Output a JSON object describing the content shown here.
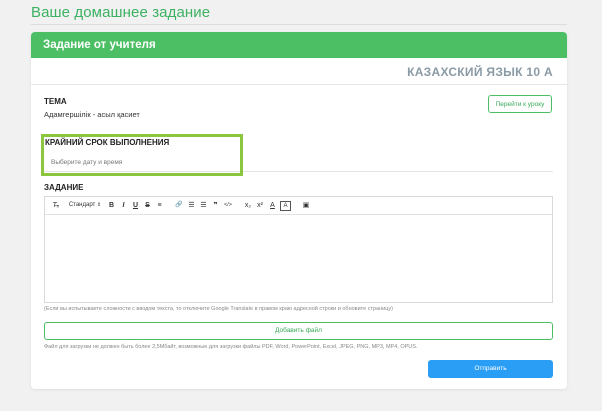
{
  "page": {
    "heading": "Ваше домашнее задание"
  },
  "card": {
    "header": "Задание от учителя",
    "subject": "КАЗАХСКИЙ ЯЗЫК 10 А"
  },
  "topic": {
    "label": "ТЕМА",
    "value": "Адамгершілік - асыл қасиет",
    "goto_button": "Перейти к уроку"
  },
  "deadline": {
    "label": "КРАЙНИЙ СРОК ВЫПОЛНЕНИЯ",
    "placeholder": "Выберите дату и время"
  },
  "assignment": {
    "label": "ЗАДАНИЕ",
    "toolbar": {
      "clear_format": "T̶ₓ",
      "style": "Стандарт",
      "bold": "B",
      "italic": "I",
      "underline": "U",
      "strike": "S",
      "align": "≡",
      "link": "🔗",
      "ol": "☰",
      "ul": "☰",
      "quote": "❞",
      "code": "</>",
      "subscript": "x₂",
      "superscript": "x²",
      "text_color": "A",
      "bg_color": "A",
      "video": "▣"
    },
    "hint": "(Если вы испытываете сложности с вводом текста, то отключите Google Translate в правом краю адресной строки и обновите страницу)"
  },
  "files": {
    "add_button": "Добавить файл",
    "note": "Файл для загрузки не должен быть более 2,5Мбайт, возможные для загрузки файлы PDF, Word, PowerPoint, Excel, JPEG, PNG, MP3, MP4, OPUS."
  },
  "submit": {
    "label": "Отправить"
  },
  "colors": {
    "accent_green": "#4cbf65",
    "submit_blue": "#2a9df4",
    "highlight": "#8cc63f"
  }
}
